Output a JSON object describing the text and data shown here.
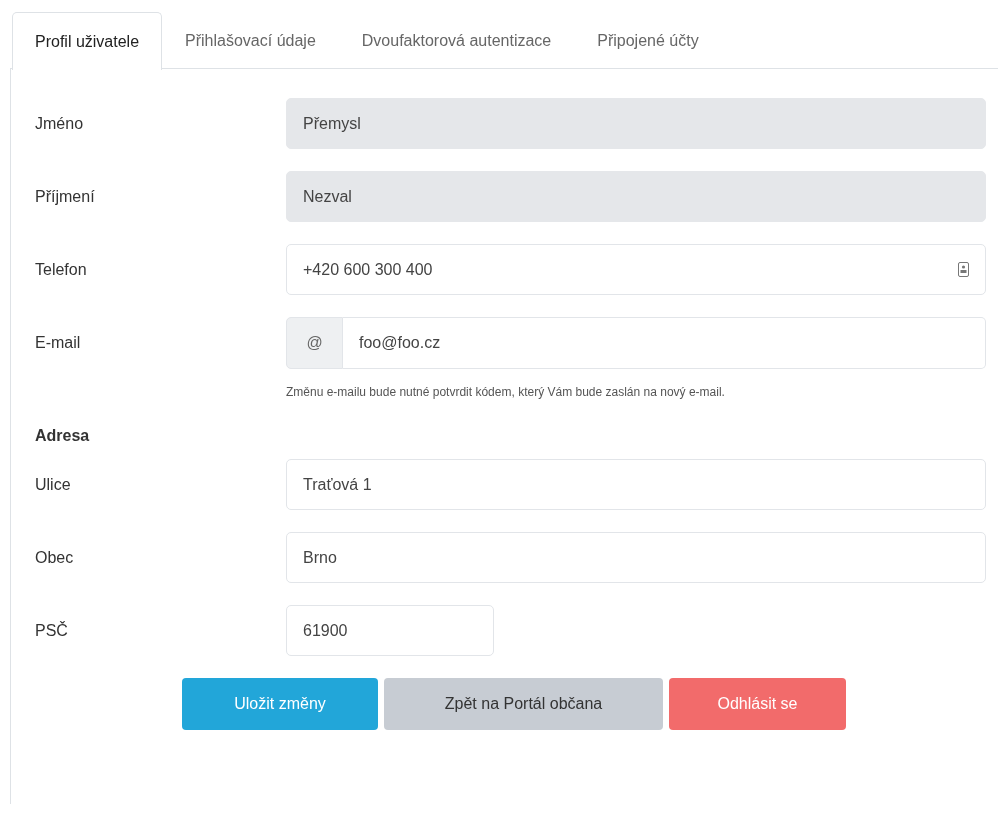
{
  "tabs": [
    {
      "label": "Profil uživatele",
      "selected": true
    },
    {
      "label": "Přihlašovací údaje",
      "selected": false
    },
    {
      "label": "Dvoufaktorová autentizace",
      "selected": false
    },
    {
      "label": "Připojené účty",
      "selected": false
    }
  ],
  "personal": [
    {
      "label": "Jméno",
      "value": "Přemysl",
      "kind": "text",
      "disabled": true
    },
    {
      "label": "Příjmení",
      "value": "Nezval",
      "kind": "text",
      "disabled": true
    },
    {
      "label": "Telefon",
      "value": "+420 600 300 400",
      "kind": "phone",
      "disabled": false
    },
    {
      "label": "E-mail",
      "value": "foo@foo.cz",
      "kind": "email",
      "prefix": "@",
      "disabled": false,
      "hint": "Změnu e-mailu bude nutné potvrdit kódem, který Vám bude zaslán na nový e-mail."
    }
  ],
  "address": {
    "heading": "Adresa",
    "fields": [
      {
        "label": "Ulice",
        "value": "Traťová 1",
        "kind": "text",
        "disabled": false
      },
      {
        "label": "Obec",
        "value": "Brno",
        "kind": "text",
        "disabled": false
      },
      {
        "label": "PSČ",
        "value": "61900",
        "kind": "postal",
        "disabled": false
      }
    ]
  },
  "buttons": [
    {
      "label": "Uložit změny",
      "kind": "primary"
    },
    {
      "label": "Zpět na Portál občana",
      "kind": "secondary"
    },
    {
      "label": "Odhlásit se",
      "kind": "danger"
    }
  ]
}
